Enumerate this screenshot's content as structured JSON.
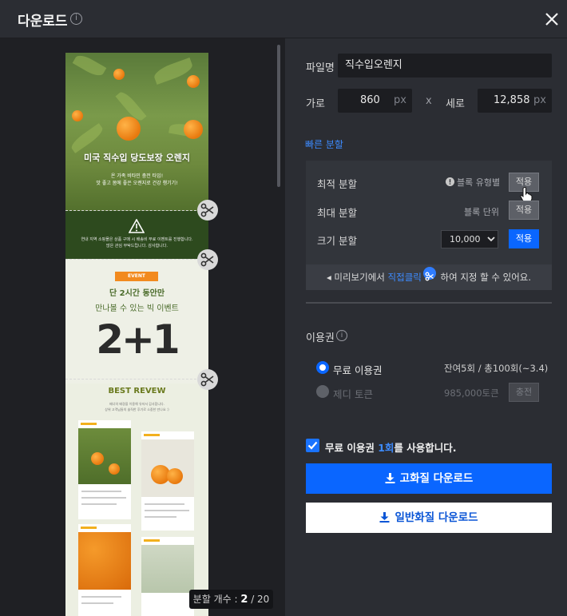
{
  "header": {
    "title": "다운로드",
    "info_icon": "info-icon",
    "close_icon": "close-icon"
  },
  "preview": {
    "hero_title": "미국 직수입 당도보장 오렌지",
    "hero_sub_1": "온 가족 비타민 충전 타임!",
    "hero_sub_2": "맛 좋고 몸에 좋은 오렌지로 건강 챙기기!",
    "notice_text_1": "연내 지역 소핑몰은 상품 구매 시 배송비 무료 이벤트를 진행합니다.",
    "notice_text_2": "많은 관심 부탁드립니다. 감사합니다.",
    "event_badge": "EVENT",
    "event_line_1": "단 2시간 동안만",
    "event_line_2": "만나볼 수 있는 빅 이벤트",
    "event_big": "2+1",
    "review_title": "BEST REVEW",
    "review_sub_1": "배너의 배경을 이용해 유저서 감사합니다.",
    "review_sub_2": "상위 고객님들의 솔직한 후기로 소중한 만나요 :)",
    "split_count_label": "분할 개수 : ",
    "split_current": "2",
    "split_total": " / 20"
  },
  "form": {
    "filename_label": "파일명",
    "filename_value": "직수입오렌지",
    "width_label": "가로",
    "width_value": "860",
    "width_unit": "px",
    "times": "x",
    "height_label": "세로",
    "height_value": "12,858",
    "height_unit": "px"
  },
  "quick_split": {
    "title": "빠른 분할",
    "optimal_label": "최적 분할",
    "optimal_hint": "블록 유형별",
    "optimal_btn": "적용",
    "max_label": "최대 분할",
    "max_hint": "블록 단위",
    "max_btn": "적용",
    "size_label": "크기 분할",
    "size_value": "10,000",
    "size_btn": "적용",
    "hint_prefix": "◂ 미리보기에서 ",
    "hint_blue": "직접클릭",
    "hint_suffix": " 하여 지정 할 수 있어요."
  },
  "license": {
    "title": "이용권",
    "free_label": "무료 이용권",
    "free_remain": "잔여5회 / 총100회(~3.4)",
    "token_label": "제디 토큰",
    "token_amount": "985,000토큰",
    "token_btn": "충전"
  },
  "consent": {
    "prefix": "무료 이용권 ",
    "blue": "1회",
    "suffix": "를 사용합니다."
  },
  "buttons": {
    "hq": "고화질 다운로드",
    "normal": "일반화질 다운로드"
  },
  "colors": {
    "accent": "#0a66ff",
    "panel": "#2b2d33",
    "preview_bg": "#1f2024"
  }
}
